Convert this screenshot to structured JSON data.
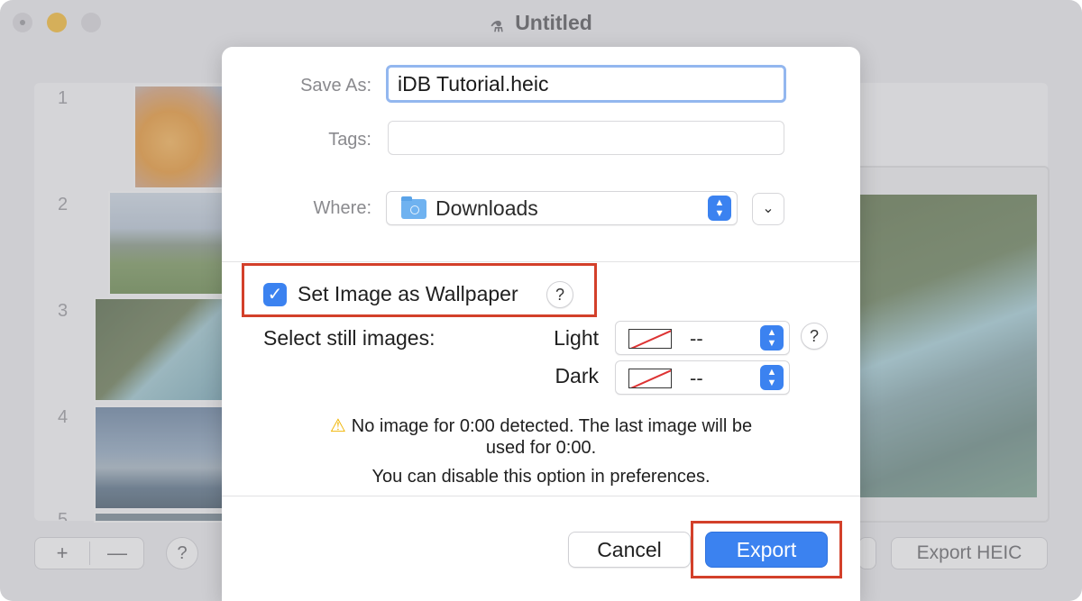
{
  "window": {
    "title": "Untitled",
    "app_icon": "app-wand-icon"
  },
  "thumbnails": {
    "row_numbers": [
      "1",
      "2",
      "3",
      "4",
      "5"
    ]
  },
  "bottom_bar": {
    "add_label": "+",
    "remove_label": "—",
    "help_label": "?",
    "export_heic_label": "Export HEIC"
  },
  "dialog": {
    "save_as": {
      "label": "Save As:",
      "value": "iDB Tutorial.heic"
    },
    "tags": {
      "label": "Tags:",
      "value": ""
    },
    "where": {
      "label": "Where:",
      "value": "Downloads",
      "icon": "folder-icon"
    },
    "wallpaper": {
      "checked": true,
      "label": "Set Image as Wallpaper",
      "help": "?"
    },
    "still_images": {
      "label": "Select still images:",
      "light_label": "Light",
      "light_value": "--",
      "dark_label": "Dark",
      "dark_value": "--",
      "help": "?"
    },
    "warning": {
      "icon": "warning-icon",
      "line1": "No image for 0:00 detected. The last image will be",
      "line2": "used for 0:00.",
      "line3": "You can disable this option in preferences."
    },
    "buttons": {
      "cancel": "Cancel",
      "export": "Export"
    }
  },
  "colors": {
    "accent": "#3b82f0",
    "highlight_annotation": "#d3402a",
    "warning": "#f0b400"
  }
}
